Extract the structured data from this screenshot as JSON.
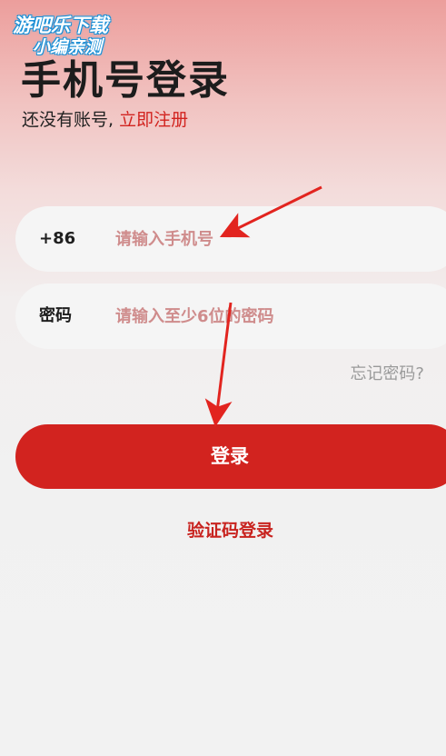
{
  "watermark": {
    "line1": "游吧乐下载",
    "line2": "小编亲测"
  },
  "page": {
    "title": "手机号登录",
    "subtitle_text": "还没有账号,",
    "register_link": "立即注册"
  },
  "phone_field": {
    "prefix": "+86",
    "placeholder": "请输入手机号",
    "value": ""
  },
  "password_field": {
    "label": "密码",
    "placeholder": "请输入至少6位的密码",
    "value": ""
  },
  "forgot_password": "忘记密码?",
  "login_button": "登录",
  "sms_login": "验证码登录",
  "colors": {
    "accent": "#d2231f",
    "placeholder": "#cf8c8c",
    "annotation_arrow": "#e2241f",
    "watermark_stroke": "#1a8fd6"
  }
}
